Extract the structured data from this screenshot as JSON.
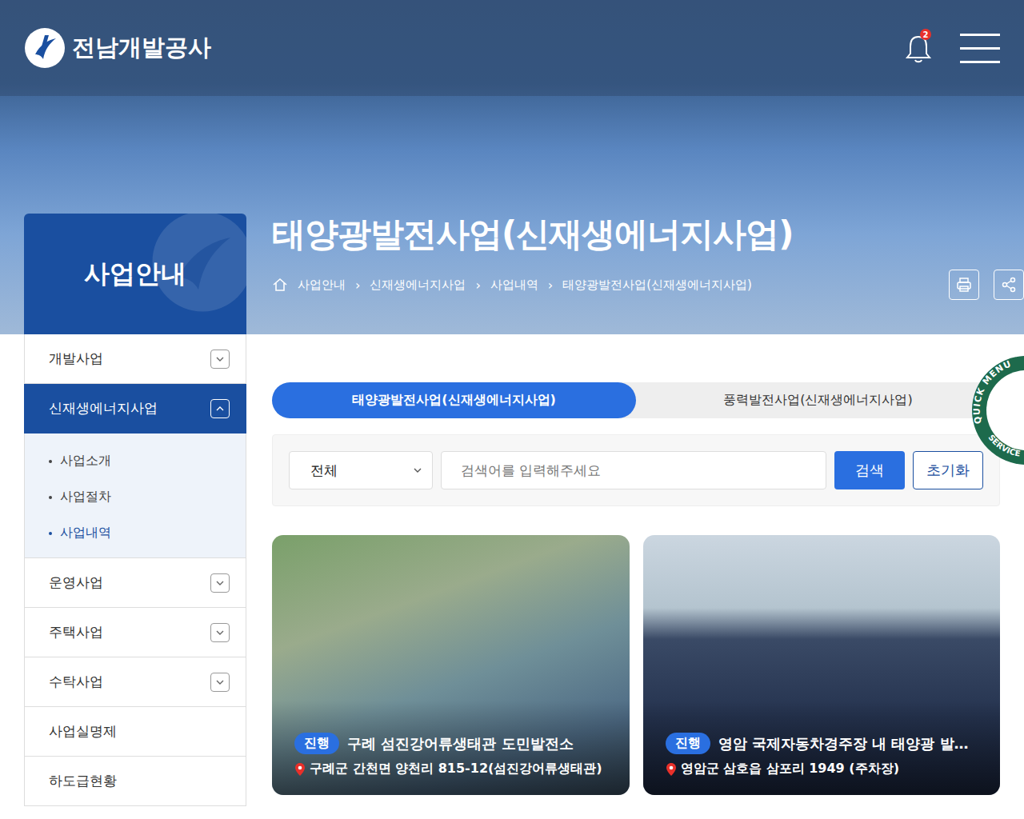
{
  "header": {
    "logo": "전남개발공사",
    "notifications": "2"
  },
  "page": {
    "section": "사업안내",
    "title": "태양광발전사업(신재생에너지사업)"
  },
  "breadcrumb": {
    "separator": "›",
    "items": [
      "사업안내",
      "신재생에너지사업",
      "사업내역",
      "태양광발전사업(신재생에너지사업)"
    ]
  },
  "sidebar": [
    {
      "label": "개발사업",
      "selected": false,
      "expandable": true,
      "expanded": false,
      "children": []
    },
    {
      "label": "신재생에너지사업",
      "selected": true,
      "expandable": true,
      "expanded": true,
      "children": [
        {
          "label": "사업소개",
          "selected": false
        },
        {
          "label": "사업절차",
          "selected": false
        },
        {
          "label": "사업내역",
          "selected": true
        }
      ]
    },
    {
      "label": "운영사업",
      "selected": false,
      "expandable": true,
      "expanded": false,
      "children": []
    },
    {
      "label": "주택사업",
      "selected": false,
      "expandable": true,
      "expanded": false,
      "children": []
    },
    {
      "label": "수탁사업",
      "selected": false,
      "expandable": true,
      "expanded": false,
      "children": []
    },
    {
      "label": "사업실명제",
      "selected": false,
      "expandable": false,
      "expanded": false,
      "children": []
    },
    {
      "label": "하도급현황",
      "selected": false,
      "expandable": false,
      "expanded": false,
      "children": []
    }
  ],
  "tabs": [
    {
      "label": "태양광발전사업(신재생에너지사업)",
      "selected": true
    },
    {
      "label": "풍력발전사업(신재생에너지사업)",
      "selected": false
    }
  ],
  "search": {
    "filter": "전체",
    "placeholder": "검색어를 입력해주세요",
    "search_button": "검색",
    "reset_button": "초기화"
  },
  "cards": [
    {
      "status": "진행",
      "title": "구례 섬진강어류생태관 도민발전소",
      "location": "구례군 간천면 양천리 815-12(섬진강어류생태관)"
    },
    {
      "status": "진행",
      "title": "영암 국제자동차경주장 내 태양광 발…",
      "location": "영암군 삼호읍 삼포리 1949 (주차장)"
    }
  ],
  "quick_menu": {
    "top": "QUICK MENU",
    "bottom": "SERVICE"
  }
}
